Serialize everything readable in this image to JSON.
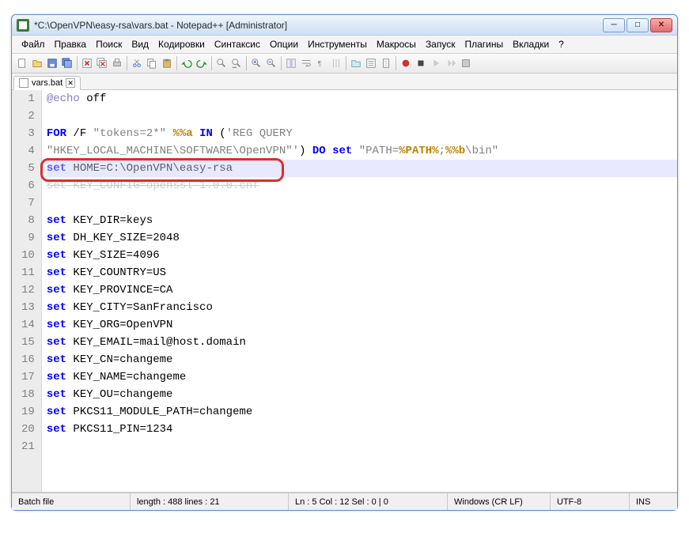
{
  "window": {
    "title": "*C:\\OpenVPN\\easy-rsa\\vars.bat - Notepad++ [Administrator]"
  },
  "menu": {
    "file": "Файл",
    "edit": "Правка",
    "search": "Поиск",
    "view": "Вид",
    "encoding": "Кодировки",
    "syntax": "Синтаксис",
    "options": "Опции",
    "tools": "Инструменты",
    "macro": "Макросы",
    "run": "Запуск",
    "plugins": "Плагины",
    "tabs": "Вкладки",
    "help": "?"
  },
  "tab": {
    "label": "vars.bat"
  },
  "code": {
    "l1_echo": "@echo",
    "l1_off": " off",
    "l3_for": "FOR",
    "l3_rest": " /F ",
    "l3_tokens": "\"tokens=2*\"",
    "l3_vara": " %%a ",
    "l3_in": "IN",
    "l3_paren": " (",
    "l3_q1": "'REG QUERY",
    "l3b_q2": "\"HKEY_LOCAL_MACHINE\\SOFTWARE\\OpenVPN\"'",
    "l3b_paren": ") ",
    "l3b_do": "DO",
    "l3b_set": " set",
    "l3b_path": " \"PATH=",
    "l3b_pathvar": "%PATH%",
    "l3b_sep": ";",
    "l3b_bvar": "%%b",
    "l3b_bin": "\\bin\"",
    "l5_set": "set",
    "l5_rest": " HOME=C:\\OpenVPN\\easy-rsa",
    "l6_muted": "set KEY_CONFIG=openssl-1.0.0.cnf",
    "l8_set": "set",
    "l8_rest": " KEY_DIR=keys",
    "l9_set": "set",
    "l9_rest": " DH_KEY_SIZE=2048",
    "l10_set": "set",
    "l10_rest": " KEY_SIZE=4096",
    "l11_set": "set",
    "l11_rest": " KEY_COUNTRY=US",
    "l12_set": "set",
    "l12_rest": " KEY_PROVINCE=CA",
    "l13_set": "set",
    "l13_rest": " KEY_CITY=SanFrancisco",
    "l14_set": "set",
    "l14_rest": " KEY_ORG=OpenVPN",
    "l15_set": "set",
    "l15_rest": " KEY_EMAIL=mail@host.domain",
    "l16_set": "set",
    "l16_rest": " KEY_CN=changeme",
    "l17_set": "set",
    "l17_rest": " KEY_NAME=changeme",
    "l18_set": "set",
    "l18_rest": " KEY_OU=changeme",
    "l19_set": "set",
    "l19_rest": " PKCS11_MODULE_PATH=changeme",
    "l20_set": "set",
    "l20_rest": " PKCS11_PIN=1234"
  },
  "linenumbers": {
    "1": "1",
    "2": "2",
    "3": "3",
    "4": "4",
    "5": "5",
    "6": "6",
    "7": "7",
    "8": "8",
    "9": "9",
    "10": "10",
    "11": "11",
    "12": "12",
    "13": "13",
    "14": "14",
    "15": "15",
    "16": "16",
    "17": "17",
    "18": "18",
    "19": "19",
    "20": "20",
    "21": "21"
  },
  "status": {
    "lang": "Batch file",
    "length": "length : 488    lines : 21",
    "pos": "Ln : 5    Col : 12    Sel : 0 | 0",
    "eol": "Windows (CR LF)",
    "enc": "UTF-8",
    "mode": "INS"
  }
}
